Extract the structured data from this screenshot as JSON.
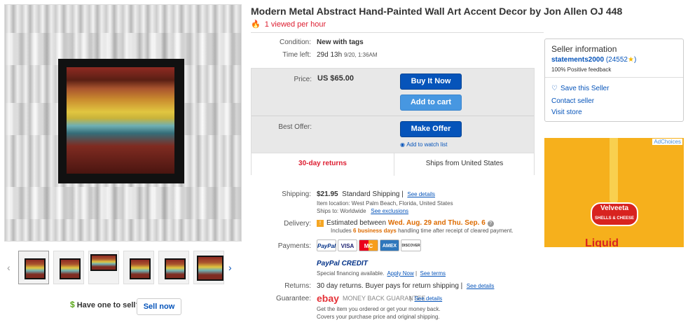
{
  "listing": {
    "title": "Modern Metal Abstract Hand-Painted Wall Art Accent Decor by Jon Allen OJ 448",
    "views": "1 viewed per hour"
  },
  "details": {
    "condition_label": "Condition:",
    "condition_value": "New with tags",
    "timeleft_label": "Time left:",
    "timeleft_value": "29d 13h",
    "timeleft_date": "9/20, 1:36AM"
  },
  "purchase": {
    "price_label": "Price:",
    "price_value": "US $65.00",
    "buy_now": "Buy It Now",
    "add_cart": "Add to cart",
    "offer_label": "Best Offer:",
    "make_offer": "Make Offer",
    "watch": "Add to watch list",
    "returns": "30-day returns",
    "ships_from": "Ships from United States"
  },
  "shipping": {
    "label": "Shipping:",
    "cost": "$21.95",
    "method": "Standard Shipping",
    "see_details": "See details",
    "location": "Item location:  West Palm Beach, Florida, United States",
    "ships_to": "Ships to:  Worldwide",
    "see_exclusions": "See exclusions"
  },
  "delivery": {
    "label": "Delivery:",
    "estimated_prefix": "Estimated between",
    "dates": "Wed. Aug. 29 and Thu. Sep. 6",
    "includes": "Includes",
    "business_days": "6 business days",
    "handling": "handling time after receipt of cleared payment."
  },
  "payments": {
    "label": "Payments:",
    "logos": [
      "PayPal",
      "VISA",
      "MC",
      "AMEX",
      "DISCOVER"
    ],
    "credit_title": "PayPal CREDIT",
    "financing": "Special financing available.",
    "apply_now": "Apply Now",
    "see_terms": "See terms"
  },
  "returns_row": {
    "label": "Returns:",
    "text": "30 day returns. Buyer pays for return shipping",
    "see_details": "See details"
  },
  "guarantee": {
    "label": "Guarantee:",
    "ebay": "ebay",
    "mbg": "MONEY BACK GUARANTEE",
    "see_details": "See details",
    "line1": "Get the item you ordered or get your money back.",
    "line2": "Covers your purchase price and original shipping."
  },
  "seller": {
    "heading": "Seller information",
    "name": "statements2000",
    "score": "(24552",
    "score_close": ")",
    "feedback": "100% Positive feedback",
    "save": "Save this Seller",
    "contact": "Contact seller",
    "visit": "Visit store"
  },
  "ad": {
    "choices": "AdChoices",
    "brand": "Velveeta",
    "brand_sub": "SHELLS & CHEESE",
    "bottom": "Liquid"
  },
  "sell": {
    "dollar": "$",
    "label": "Have one to sell?",
    "button": "Sell now"
  },
  "colors": {
    "link": "#0654ba",
    "red": "#dd1e31",
    "orange": "#dd6b00"
  }
}
